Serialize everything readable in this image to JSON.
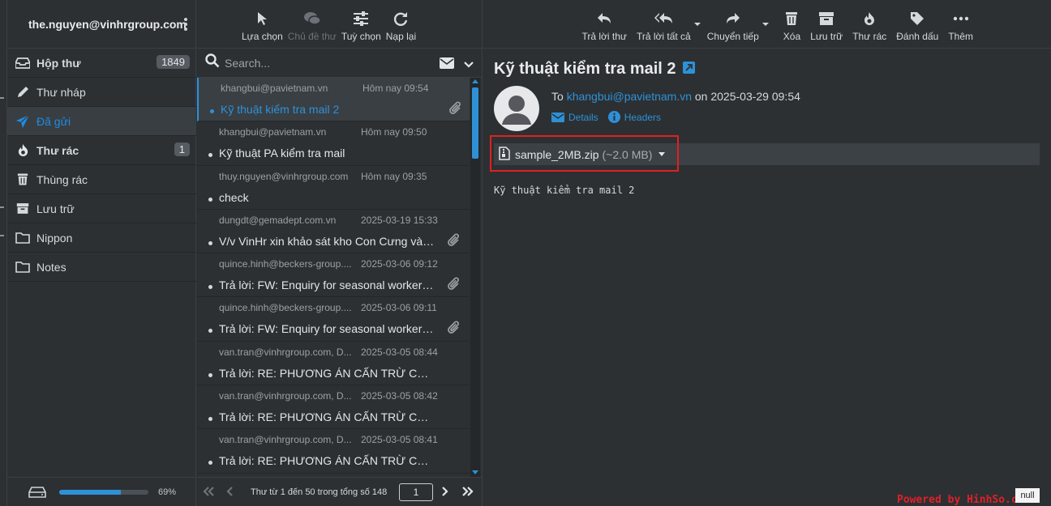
{
  "account": {
    "email": "the.nguyen@vinhrgroup.com"
  },
  "folders": [
    {
      "label": "Hộp thư",
      "count": "1849",
      "icon": "inbox-icon",
      "bold": true
    },
    {
      "label": "Thư nháp",
      "icon": "pencil-icon"
    },
    {
      "label": "Đã gửi",
      "icon": "send-icon",
      "active": true
    },
    {
      "label": "Thư rác",
      "count": "1",
      "icon": "fire-icon",
      "bold": true
    },
    {
      "label": "Thùng rác",
      "icon": "trash-icon"
    },
    {
      "label": "Lưu trữ",
      "icon": "archive-icon"
    },
    {
      "label": "Nippon",
      "icon": "folder-icon"
    },
    {
      "label": "Notes",
      "icon": "folder-icon"
    }
  ],
  "quota": {
    "percent_label": "69%",
    "fraction": 0.69
  },
  "list_toolbar": {
    "select": "Lựa chọn",
    "threads": "Chủ đề thư",
    "options": "Tuỳ chọn",
    "refresh": "Nạp lại"
  },
  "search": {
    "placeholder": "Search..."
  },
  "messages": [
    {
      "from": "khangbui@pavietnam.vn",
      "date": "Hôm nay 09:54",
      "subject": "Kỹ thuật kiểm tra mail 2",
      "attachment": true,
      "selected": true
    },
    {
      "from": "khangbui@pavietnam.vn",
      "date": "Hôm nay 09:50",
      "subject": "Kỹ thuật PA kiểm tra mail",
      "attachment": false
    },
    {
      "from": "thuy.nguyen@vinhrgroup.com",
      "date": "Hôm nay 09:35",
      "subject": "check",
      "attachment": false
    },
    {
      "from": "dungdt@gemadept.com.vn",
      "date": "2025-03-19 15:33",
      "subject": "V/v VinHr xin khảo sát kho Con Cưng và k...",
      "attachment": true
    },
    {
      "from": "quince.hinh@beckers-group....",
      "date": "2025-03-06 09:12",
      "subject": "Trả lời: FW: Enquiry for seasonal worker_ ...",
      "attachment": true
    },
    {
      "from": "quince.hinh@beckers-group....",
      "date": "2025-03-06 09:11",
      "subject": "Trả lời: FW: Enquiry for seasonal worker_ ...",
      "attachment": true
    },
    {
      "from": "van.tran@vinhrgroup.com, D...",
      "date": "2025-03-05 08:44",
      "subject": "Trả lời: RE: PHƯƠNG ÁN CẤN TRỪ CÔNG ...",
      "attachment": false
    },
    {
      "from": "van.tran@vinhrgroup.com, D...",
      "date": "2025-03-05 08:42",
      "subject": "Trả lời: RE: PHƯƠNG ÁN CẤN TRỪ CÔNG ...",
      "attachment": false
    },
    {
      "from": "van.tran@vinhrgroup.com, D...",
      "date": "2025-03-05 08:41",
      "subject": "Trả lời: RE: PHƯƠNG ÁN CẤN TRỪ CÔNG ...",
      "attachment": false
    }
  ],
  "pager": {
    "text": "Thư từ 1 đến 50 trong tổng số 148",
    "page": "1"
  },
  "reader_toolbar": {
    "reply": "Trả lời thư",
    "reply_all": "Trả lời tất cả",
    "forward": "Chuyển tiếp",
    "delete": "Xóa",
    "archive": "Lưu trữ",
    "spam": "Thư rác",
    "mark": "Đánh dấu",
    "more": "Thêm"
  },
  "message": {
    "subject": "Kỹ thuật kiểm tra mail 2",
    "to_prefix": "To",
    "to": "khangbui@pavietnam.vn",
    "date_text": "on 2025-03-29 09:54",
    "details": "Details",
    "headers": "Headers",
    "attachment_name": "sample_2MB.zip",
    "attachment_size": "(~2.0 MB)",
    "body": "Kỹ thuật kiểm tra mail 2"
  },
  "watermark": {
    "text": "Powered by HinhSo.com",
    "box": "null"
  },
  "colors": {
    "accent": "#2e91d8",
    "background": "#2c3033",
    "highlight": "#e02020"
  }
}
